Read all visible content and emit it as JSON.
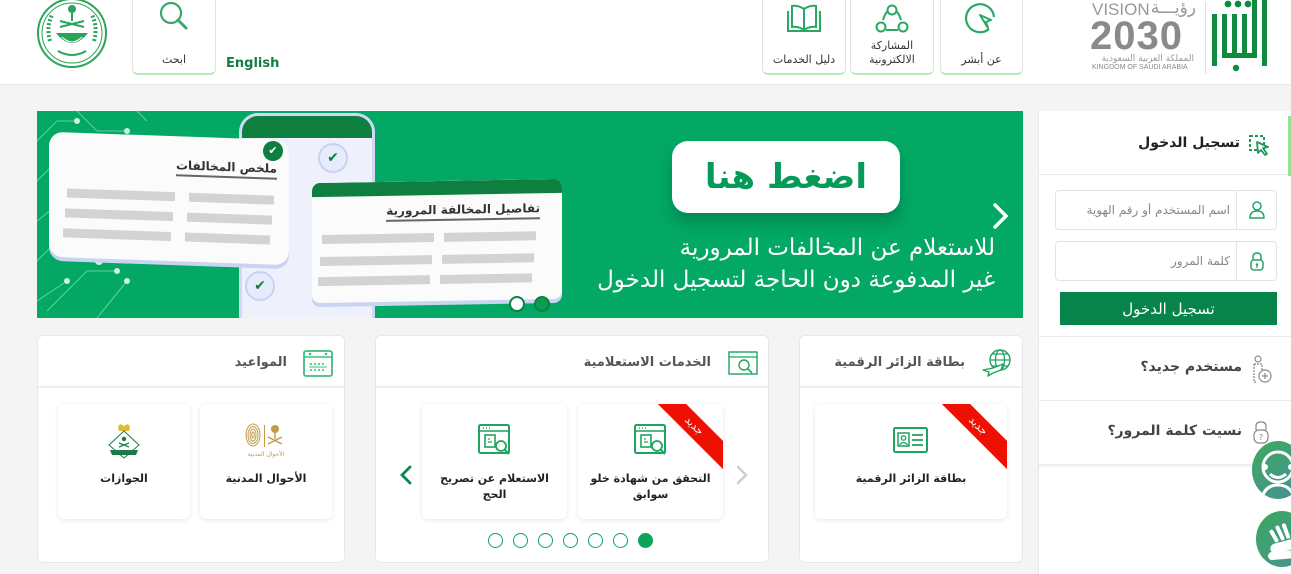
{
  "header": {
    "english_link": "English",
    "search_label": "ابحث",
    "nav": [
      {
        "label": "عن أبشر",
        "icon": "pointer-circle-icon"
      },
      {
        "label": "المشاركة الالكترونية",
        "icon": "network-share-icon"
      },
      {
        "label": "دليل الخدمات",
        "icon": "open-book-icon"
      }
    ],
    "vision_logo": {
      "vision": "VISION",
      "vision_ar": "رؤيـــة",
      "year": "2030",
      "kingdom_ar": "المملكة العربية السعودية",
      "kingdom_en": "KINGDOM OF SAUDI ARABIA"
    }
  },
  "banner": {
    "card_summary_title": "ملخص المخالفات",
    "card_details_title": "تفاصيل المخالفة المرورية",
    "cta": "اضغط هنا",
    "line1": "للاستعلام عن المخالفات المرورية",
    "line2": "غير المدفوعة دون الحاجة لتسجيل الدخول",
    "slides_total": 2,
    "active_slide": 2
  },
  "login": {
    "title": "تسجيل الدخول",
    "username_placeholder": "اسم المستخدم أو رقم الهوية",
    "password_placeholder": "كلمة المرور",
    "username_value": "",
    "password_value": "",
    "submit": "تسجيل الدخول",
    "new_user": "مستخدم جديد؟",
    "forgot_password": "نسيت كلمة المرور؟"
  },
  "sections": {
    "visitor": {
      "title": "بطاقة الزائر الرقمية",
      "tiles": [
        {
          "label": "بطاقة الزائر الرقمية",
          "badge": "جديد"
        }
      ]
    },
    "inquiry": {
      "title": "الخدمات الاستعلامية",
      "tiles": [
        {
          "label": "التحقق من شهادة خلو سوابق",
          "badge": "جديد"
        },
        {
          "label": "الاستعلام عن تصريح الحج",
          "badge": ""
        }
      ],
      "pages_total": 7,
      "active_page": 1
    },
    "appointments": {
      "title": "المواعيد",
      "tiles": [
        {
          "label": "الأحوال المدنية",
          "logo_text": "الأحوال المدنية"
        },
        {
          "label": "الجوازات"
        }
      ]
    }
  },
  "colors": {
    "brand_green": "#07844a",
    "banner_green": "#02a863",
    "accent_light_green": "#98e48e",
    "badge_red": "#ee1103"
  }
}
